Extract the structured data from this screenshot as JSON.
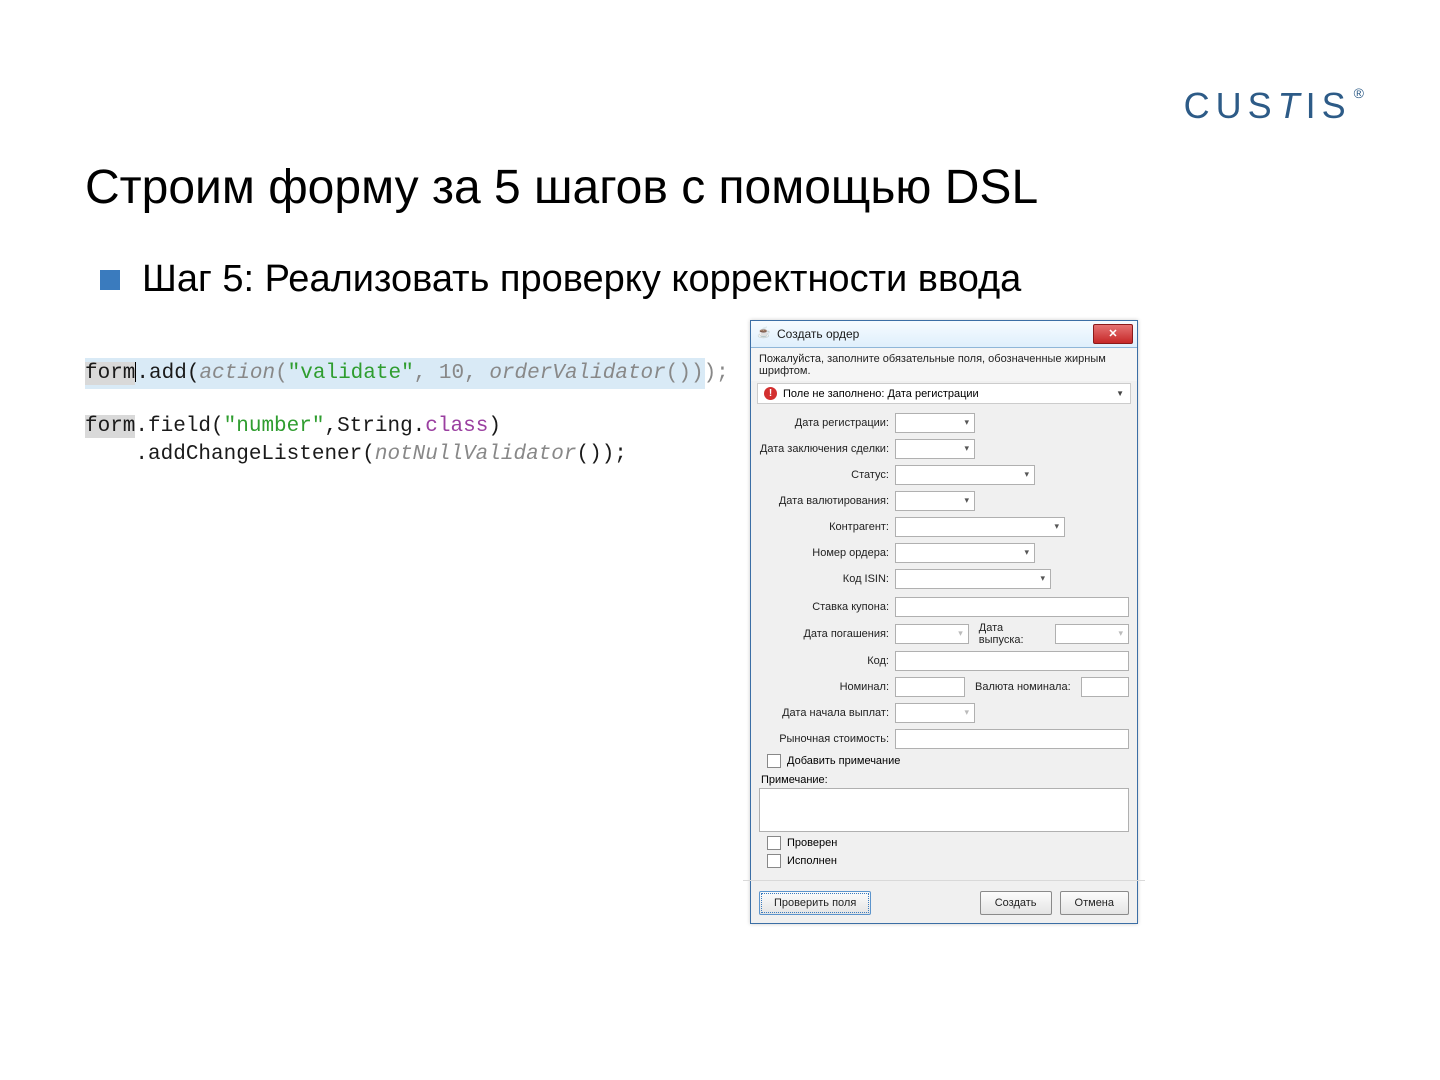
{
  "brand": "CUSTIS®",
  "title": "Строим форму за 5 шагов с помощью DSL",
  "bullet": "Шаг 5: Реализовать проверку корректности ввода",
  "code": {
    "l1_form": "form",
    "l1_rest_a": ".add(",
    "l1_rest_b": "action",
    "l1_rest_c": "(",
    "l1_str": "\"validate\"",
    "l1_rest_d": ", 10, ",
    "l1_rest_e": "orderValidator",
    "l1_rest_f": "()));",
    "l2_form": "form",
    "l2_a": ".field(",
    "l2_str": "\"number\"",
    "l2_b": ",String.",
    "l2_class": "class",
    "l2_c": ")",
    "l3_a": "    .addChangeListener(",
    "l3_b": "notNullValidator",
    "l3_c": "());"
  },
  "dialog": {
    "title": "Создать ордер",
    "instruction": "Пожалуйста, заполните обязательные поля, обозначенные жирным шрифтом.",
    "error": "Поле не заполнено: Дата регистрации",
    "fields": {
      "reg_date": "Дата регистрации:",
      "deal_date": "Дата заключения сделки:",
      "status": "Статус:",
      "value_date": "Дата валютирования:",
      "counterparty": "Контрагент:",
      "order_no": "Номер ордера:",
      "isin": "Код ISIN:",
      "coupon": "Ставка купона:",
      "maturity": "Дата погашения:",
      "issue": "Дата выпуска:",
      "code": "Код:",
      "nominal": "Номинал:",
      "nominal_ccy": "Валюта номинала:",
      "pay_start": "Дата начала выплат:",
      "market_val": "Рыночная стоимость:"
    },
    "add_note": "Добавить примечание",
    "note_label": "Примечание:",
    "checked_lbl": "Проверен",
    "executed_lbl": "Исполнен",
    "btn_validate": "Проверить поля",
    "btn_create": "Создать",
    "btn_cancel": "Отмена"
  }
}
